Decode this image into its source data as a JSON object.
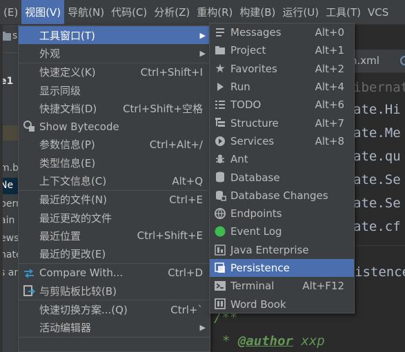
{
  "menubar": {
    "items": [
      "(E)",
      "视图(V)",
      "导航(N)",
      "代码(C)",
      "分析(Z)",
      "重构(R)",
      "构建(B)",
      "运行(U)",
      "工具(T)",
      "VCS"
    ]
  },
  "background": {
    "left_texts": [
      "s",
      "e1",
      "m.b",
      "Ne",
      "bern",
      "ain",
      "ews.",
      "nate",
      "s an"
    ],
    "tab_label": "n.xml",
    "code_lines": [
      "ibernat",
      "ate.Hi",
      "ate.Me",
      "ate.qu",
      "ate.Se",
      "ate.Se",
      "ate.cf",
      "istence"
    ],
    "comment_open": "/**",
    "comment_author_tag": "@author",
    "comment_author": "xxp"
  },
  "view_menu": {
    "items": [
      {
        "label": "工具窗口(T)",
        "shortcut": "",
        "submenu": true,
        "icon": ""
      },
      {
        "label": "外观",
        "shortcut": "",
        "submenu": true,
        "icon": ""
      },
      {
        "label": "快速定义(K)",
        "shortcut": "Ctrl+Shift+I",
        "submenu": false,
        "icon": ""
      },
      {
        "label": "显示同级",
        "shortcut": "",
        "submenu": false,
        "icon": ""
      },
      {
        "label": "快捷文档(D)",
        "shortcut": "Ctrl+Shift+空格",
        "submenu": false,
        "icon": ""
      },
      {
        "label": "Show Bytecode",
        "shortcut": "",
        "submenu": false,
        "icon": "bytecode-icon"
      },
      {
        "label": "参数信息(P)",
        "shortcut": "Ctrl+Alt+/",
        "submenu": false,
        "icon": ""
      },
      {
        "label": "类型信息(E)",
        "shortcut": "",
        "submenu": false,
        "icon": ""
      },
      {
        "label": "上下文信息(C)",
        "shortcut": "Alt+Q",
        "submenu": false,
        "icon": ""
      },
      {
        "label": "最近的文件(N)",
        "shortcut": "Ctrl+E",
        "submenu": false,
        "icon": ""
      },
      {
        "label": "最近更改的文件",
        "shortcut": "",
        "submenu": false,
        "icon": ""
      },
      {
        "label": "最近位置",
        "shortcut": "Ctrl+Shift+E",
        "submenu": false,
        "icon": ""
      },
      {
        "label": "最近的更改(E)",
        "shortcut": "",
        "submenu": false,
        "icon": ""
      },
      {
        "label": "Compare With...",
        "shortcut": "Ctrl+D",
        "submenu": false,
        "icon": "compare-icon"
      },
      {
        "label": "与剪贴板比较(B)",
        "shortcut": "",
        "submenu": false,
        "icon": "clipboard-compare-icon"
      },
      {
        "label": "快速切换方案...(Q)",
        "shortcut": "Ctrl+`",
        "submenu": false,
        "icon": ""
      },
      {
        "label": "活动编辑器",
        "shortcut": "",
        "submenu": true,
        "icon": ""
      },
      {
        "label": "",
        "shortcut": "",
        "submenu": false,
        "icon": ""
      }
    ]
  },
  "tool_windows_menu": {
    "items": [
      {
        "label": "Messages",
        "shortcut": "Alt+0",
        "icon": "messages-icon"
      },
      {
        "label": "Project",
        "shortcut": "Alt+1",
        "icon": "folder-icon"
      },
      {
        "label": "Favorites",
        "shortcut": "Alt+2",
        "icon": "star-icon"
      },
      {
        "label": "Run",
        "shortcut": "Alt+4",
        "icon": "run-icon"
      },
      {
        "label": "TODO",
        "shortcut": "Alt+6",
        "icon": "todo-icon"
      },
      {
        "label": "Structure",
        "shortcut": "Alt+7",
        "icon": "structure-icon"
      },
      {
        "label": "Services",
        "shortcut": "Alt+8",
        "icon": "services-icon"
      },
      {
        "label": "Ant",
        "shortcut": "",
        "icon": "ant-icon"
      },
      {
        "label": "Database",
        "shortcut": "",
        "icon": "database-icon"
      },
      {
        "label": "Database Changes",
        "shortcut": "",
        "icon": "database-changes-icon"
      },
      {
        "label": "Endpoints",
        "shortcut": "",
        "icon": "endpoints-icon"
      },
      {
        "label": "Event Log",
        "shortcut": "",
        "icon": "event-log-icon"
      },
      {
        "label": "Java Enterprise",
        "shortcut": "",
        "icon": "java-enterprise-icon"
      },
      {
        "label": "Persistence",
        "shortcut": "",
        "icon": "persistence-icon"
      },
      {
        "label": "Terminal",
        "shortcut": "Alt+F12",
        "icon": "terminal-icon"
      },
      {
        "label": "Word Book",
        "shortcut": "",
        "icon": "word-book-icon"
      }
    ]
  },
  "colors": {
    "menu_bg": "#3c3f41",
    "highlight": "#4b6eaf",
    "editor_bg": "#2b2b2b",
    "event_log_green": "#3fb950",
    "comment_italic": "#629755"
  }
}
